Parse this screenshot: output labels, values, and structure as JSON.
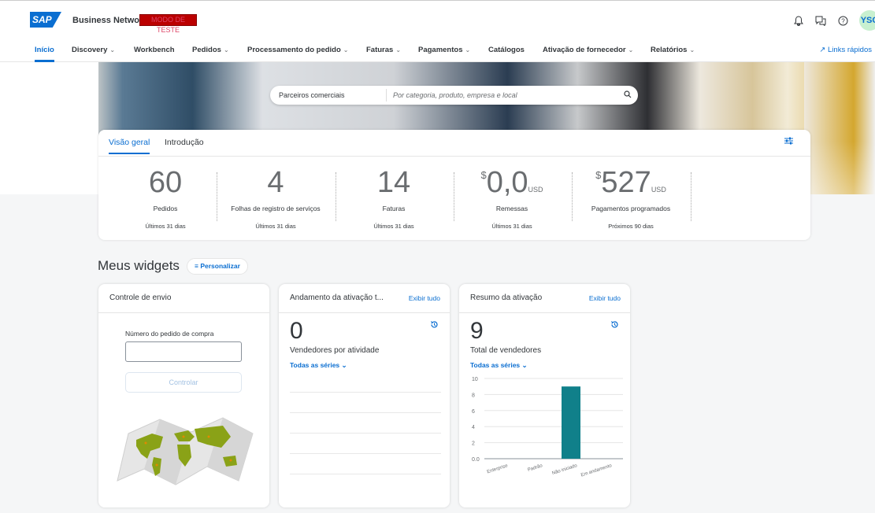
{
  "shell": {
    "logo_text": "SAP",
    "brand": "Business Network",
    "test_badge": "MODO DE TESTE",
    "avatar": "YSC",
    "icons": [
      "bell-icon",
      "feedback-icon",
      "help-icon"
    ]
  },
  "nav": {
    "items": [
      {
        "label": "Início",
        "chevron": false,
        "active": true
      },
      {
        "label": "Discovery",
        "chevron": true
      },
      {
        "label": "Workbench",
        "chevron": false
      },
      {
        "label": "Pedidos",
        "chevron": true
      },
      {
        "label": "Processamento do pedido",
        "chevron": true
      },
      {
        "label": "Faturas",
        "chevron": true
      },
      {
        "label": "Pagamentos",
        "chevron": true
      },
      {
        "label": "Catálogos",
        "chevron": false
      },
      {
        "label": "Ativação de fornecedor",
        "chevron": true
      },
      {
        "label": "Relatórios",
        "chevron": true
      }
    ],
    "quick_links": "Links rápidos"
  },
  "search": {
    "category": "Parceiros comerciais",
    "placeholder": "Por categoria, produto, empresa e local"
  },
  "overview": {
    "tabs": [
      {
        "label": "Visão geral",
        "active": true
      },
      {
        "label": "Introdução",
        "active": false
      }
    ],
    "kpis": [
      {
        "value": "60",
        "currency": "",
        "unit": "",
        "label": "Pedidos",
        "period": "Últimos 31 dias"
      },
      {
        "value": "4",
        "currency": "",
        "unit": "",
        "label": "Folhas de registro de serviços",
        "period": "Últimos 31 dias"
      },
      {
        "value": "14",
        "currency": "",
        "unit": "",
        "label": "Faturas",
        "period": "Últimos 31 dias"
      },
      {
        "value": "0,0",
        "currency": "$",
        "unit": "USD",
        "label": "Remessas",
        "period": "Últimos 31 dias"
      },
      {
        "value": "527",
        "currency": "$",
        "unit": "USD",
        "label": "Pagamentos programados",
        "period": "Próximos 90 dias"
      }
    ]
  },
  "widgets": {
    "title": "Meus widgets",
    "customize": "Personalizar",
    "shipment": {
      "title": "Controle de envio",
      "po_label": "Número do pedido de compra",
      "po_value": "",
      "track_button": "Controlar"
    },
    "progress": {
      "title": "Andamento da ativação t...",
      "link": "Exibir tudo",
      "value": "0",
      "label": "Vendedores por atividade",
      "series": "Todas as séries"
    },
    "summary": {
      "title": "Resumo da ativação",
      "link": "Exibir tudo",
      "value": "9",
      "label": "Total de vendedores",
      "series": "Todas as séries"
    }
  },
  "chart_data": {
    "type": "bar",
    "categories": [
      "Enterprise",
      "Padrão",
      "Não iniciado",
      "Em andamento"
    ],
    "values": [
      0,
      0,
      9,
      0
    ],
    "ylim": [
      0,
      10
    ],
    "yticks": [
      "0.0",
      "2",
      "4",
      "6",
      "8",
      "10"
    ],
    "bar_color": "#10808a"
  },
  "colors": {
    "accent": "#0a6ed1",
    "test_badge": "#bb0000"
  }
}
